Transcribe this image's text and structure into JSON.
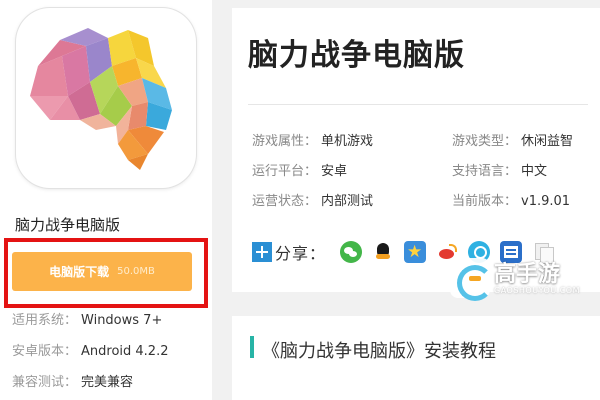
{
  "app": {
    "name": "脑力战争电脑版",
    "title": "脑力战争电脑版"
  },
  "download": {
    "label": "电脑版下载",
    "size": "50.0MB",
    "accent": "#fcb34a",
    "highlight": "#e41313"
  },
  "specs": [
    {
      "key": "适用系统：",
      "value": "Windows 7+"
    },
    {
      "key": "安卓版本：",
      "value": "Android 4.2.2"
    },
    {
      "key": "兼容测试：",
      "value": "完美兼容"
    }
  ],
  "attributes": [
    {
      "key": "游戏属性：",
      "value": "单机游戏"
    },
    {
      "key": "游戏类型：",
      "value": "休闲益智"
    },
    {
      "key": "运行平台：",
      "value": "安卓"
    },
    {
      "key": "支持语言：",
      "value": "中文"
    },
    {
      "key": "运营状态：",
      "value": "内部测试"
    },
    {
      "key": "当前版本：",
      "value": "v1.9.01"
    }
  ],
  "share": {
    "label": "分享：",
    "icons": [
      "wechat-icon",
      "qq-icon",
      "qzone-icon",
      "weibo-icon",
      "tencent-weibo-icon",
      "renren-icon",
      "copy-icon"
    ]
  },
  "tutorial": {
    "title": "《脑力战争电脑版》安装教程",
    "accent": "#27b4a6"
  },
  "watermark": {
    "brand": "高手游",
    "url": "GAOSHOUYOU.COM"
  }
}
